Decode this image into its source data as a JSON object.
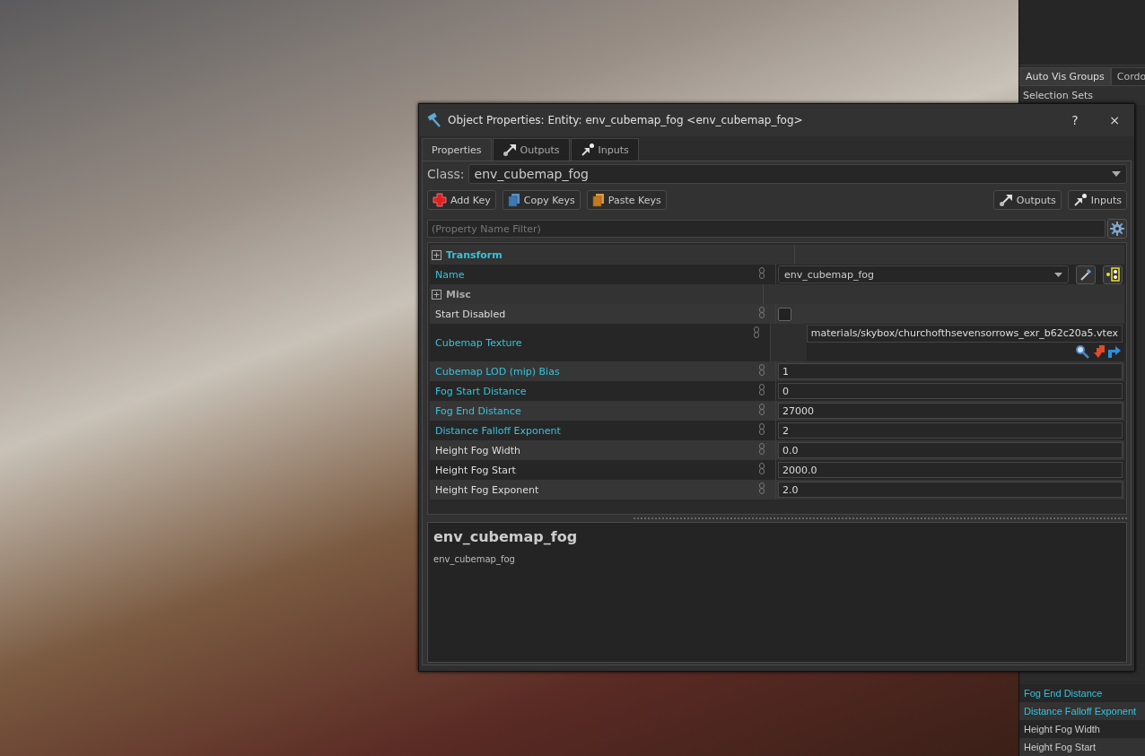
{
  "window": {
    "title": "Object Properties: Entity: env_cubemap_fog <env_cubemap_fog>",
    "help_button": "?",
    "close_button": "×"
  },
  "tabs": [
    {
      "label": "Properties",
      "selected": true,
      "kind": "plain"
    },
    {
      "label": "Outputs",
      "selected": false,
      "kind": "outputs"
    },
    {
      "label": "Inputs",
      "selected": false,
      "kind": "inputs"
    }
  ],
  "class": {
    "label": "Class:",
    "value": "env_cubemap_fog"
  },
  "key_buttons": [
    {
      "label": "Add Key",
      "kind": "add"
    },
    {
      "label": "Copy Keys",
      "kind": "copy"
    },
    {
      "label": "Paste Keys",
      "kind": "paste"
    }
  ],
  "io_buttons": [
    {
      "label": "Outputs",
      "kind": "outputs"
    },
    {
      "label": "Inputs",
      "kind": "inputs"
    }
  ],
  "filter": {
    "placeholder": "(Property Name Filter)"
  },
  "groups": [
    {
      "label": "Transform",
      "modified": true,
      "properties": [
        {
          "label": "Name",
          "modified": true,
          "kind": "combo",
          "value": "env_cubemap_fog"
        }
      ]
    },
    {
      "label": "Misc",
      "modified": false,
      "properties": [
        {
          "label": "Start Disabled",
          "modified": false,
          "kind": "checkbox",
          "checked": false
        },
        {
          "label": "Cubemap Texture",
          "modified": true,
          "kind": "texture",
          "value": "materials/skybox/churchofthsevensorrows_exr_b62c20a5.vtex"
        },
        {
          "label": "Cubemap LOD (mip) Bias",
          "modified": true,
          "kind": "text",
          "value": "1"
        },
        {
          "label": "Fog Start Distance",
          "modified": true,
          "kind": "text",
          "value": "0"
        },
        {
          "label": "Fog End Distance",
          "modified": true,
          "kind": "text",
          "value": "27000"
        },
        {
          "label": "Distance Falloff Exponent",
          "modified": true,
          "kind": "text",
          "value": "2"
        },
        {
          "label": "Height Fog Width",
          "modified": false,
          "kind": "text",
          "value": "0.0"
        },
        {
          "label": "Height Fog Start",
          "modified": false,
          "kind": "text",
          "value": "2000.0"
        },
        {
          "label": "Height Fog Exponent",
          "modified": false,
          "kind": "text",
          "value": "2.0"
        }
      ]
    }
  ],
  "help": {
    "title": "env_cubemap_fog",
    "text": "env_cubemap_fog"
  },
  "side_panel": {
    "tabs": [
      {
        "label": "Auto Vis Groups",
        "selected": true
      },
      {
        "label": "Cordo",
        "selected": false
      }
    ],
    "heading": "Selection Sets",
    "properties": [
      {
        "label": "Fog End Distance",
        "modified": true
      },
      {
        "label": "Distance Falloff Exponent",
        "modified": true
      },
      {
        "label": "Height Fog Width",
        "modified": false
      },
      {
        "label": "Height Fog Start",
        "modified": false
      }
    ]
  }
}
